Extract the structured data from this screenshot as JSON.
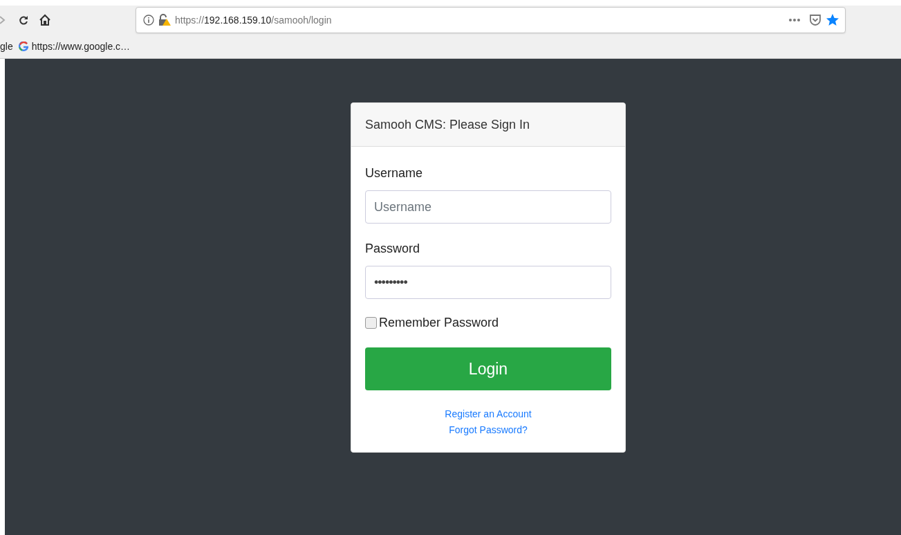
{
  "browser": {
    "url": {
      "scheme": "https://",
      "host": "192.168.159.10",
      "path": "/samooh/login"
    },
    "bookmarked": true,
    "bookmarks": [
      {
        "label": "gle",
        "kind": "plain"
      },
      {
        "label": "https://www.google.c…",
        "kind": "google"
      }
    ]
  },
  "login_card": {
    "title": "Samooh CMS: Please Sign In",
    "fields": [
      {
        "label": "Username",
        "placeholder": "Username",
        "kind": "username"
      },
      {
        "label": "Password",
        "value": "•••••••••",
        "kind": "password"
      }
    ],
    "remember": {
      "label": "Remember Password",
      "checked": false
    },
    "submit": "Login",
    "links": [
      "Register an Account",
      "Forgot Password?"
    ]
  }
}
